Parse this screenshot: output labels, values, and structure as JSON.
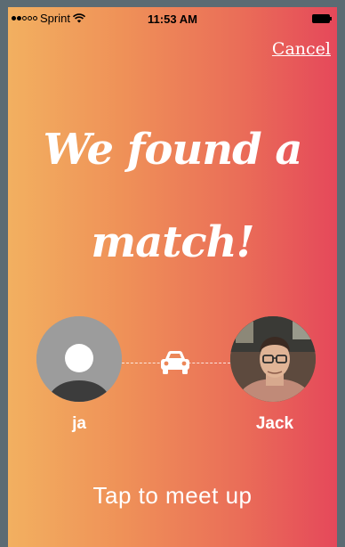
{
  "status_bar": {
    "carrier": "Sprint",
    "signal_strength": "2 of 5 dots",
    "time": "11:53 AM",
    "battery": "full"
  },
  "header": {
    "cancel_label": "Cancel"
  },
  "headline": {
    "text": "We found a match!"
  },
  "match": {
    "left_user": {
      "name": "ja",
      "avatar_icon": "default-person-icon"
    },
    "right_user": {
      "name": "Jack",
      "avatar_icon": "user-photo"
    },
    "connector_icon": "car-icon"
  },
  "cta": {
    "label": "Tap to meet up"
  },
  "colors": {
    "gradient_start": "#f2b060",
    "gradient_end": "#e5485a",
    "text": "#ffffff"
  }
}
